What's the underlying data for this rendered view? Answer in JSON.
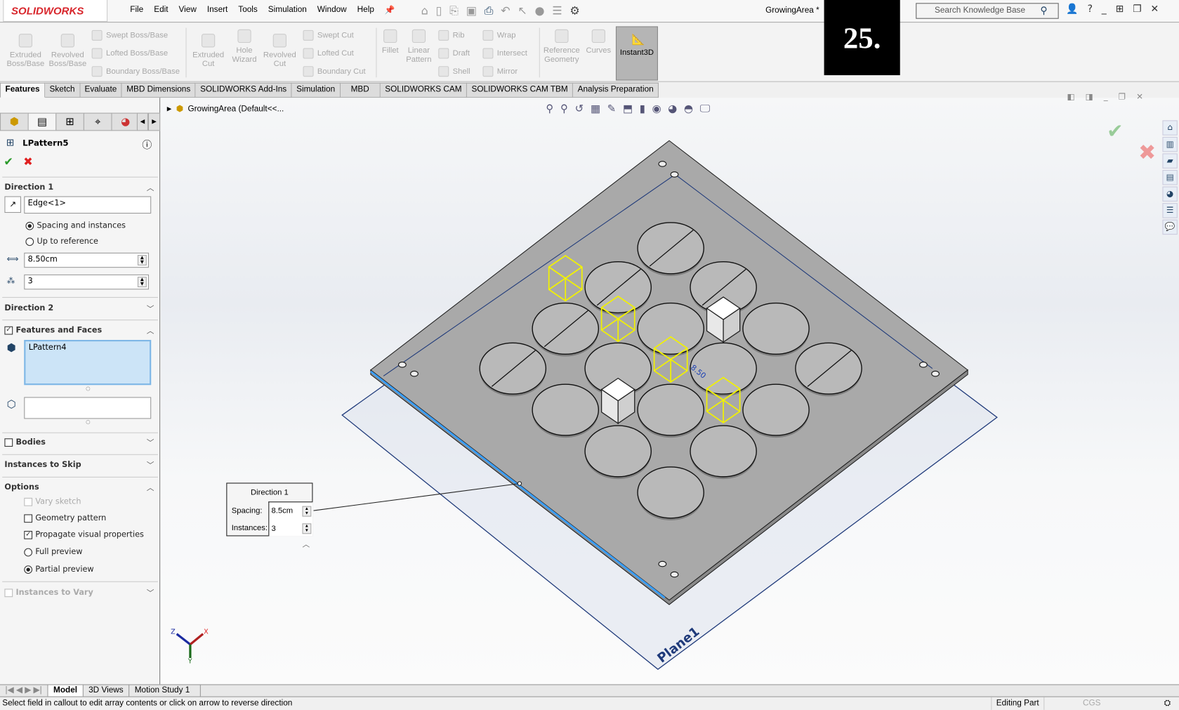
{
  "app": {
    "brand": "SOLIDWORKS",
    "document_title": "GrowingArea *",
    "step_badge": "25."
  },
  "menu": [
    "File",
    "Edit",
    "View",
    "Insert",
    "Tools",
    "Simulation",
    "Window",
    "Help"
  ],
  "search": {
    "placeholder": "Search Knowledge Base"
  },
  "ribbon": {
    "extruded_boss": "Extruded Boss/Base",
    "revolved_boss": "Revolved Boss/Base",
    "swept_boss": "Swept Boss/Base",
    "lofted_boss": "Lofted Boss/Base",
    "boundary_boss": "Boundary Boss/Base",
    "extruded_cut": "Extruded Cut",
    "hole_wizard": "Hole Wizard",
    "revolved_cut": "Revolved Cut",
    "swept_cut": "Swept Cut",
    "lofted_cut": "Lofted Cut",
    "boundary_cut": "Boundary Cut",
    "fillet": "Fillet",
    "linear_pattern": "Linear Pattern",
    "rib": "Rib",
    "draft": "Draft",
    "shell": "Shell",
    "wrap": "Wrap",
    "intersect": "Intersect",
    "mirror": "Mirror",
    "reference_geometry": "Reference Geometry",
    "curves": "Curves",
    "instant3d": "Instant3D"
  },
  "command_tabs": [
    "Features",
    "Sketch",
    "Evaluate",
    "MBD Dimensions",
    "SOLIDWORKS Add-Ins",
    "Simulation",
    "MBD",
    "SOLIDWORKS CAM",
    "SOLIDWORKS CAM TBM",
    "Analysis Preparation"
  ],
  "tree": {
    "root": "GrowingArea  (Default<<..."
  },
  "property_manager": {
    "title": "LPattern5",
    "direction1": {
      "label": "Direction 1",
      "edge": "Edge<1>",
      "opt_spacing": "Spacing and instances",
      "opt_upto": "Up to reference",
      "selected": "Spacing and instances",
      "spacing": "8.50cm",
      "instances": "3"
    },
    "direction2": {
      "label": "Direction 2"
    },
    "features": {
      "label": "Features and Faces",
      "checked": true,
      "item": "LPattern4"
    },
    "bodies": {
      "label": "Bodies",
      "checked": false
    },
    "skip": {
      "label": "Instances to Skip"
    },
    "options": {
      "label": "Options",
      "vary_sketch": "Vary sketch",
      "geometry_pattern": "Geometry pattern",
      "propagate": "Propagate visual properties",
      "full_preview": "Full preview",
      "partial_preview": "Partial preview",
      "preview_selected": "Partial preview"
    },
    "vary": {
      "label": "Instances to Vary"
    }
  },
  "callout": {
    "title": "Direction 1",
    "spacing_label": "Spacing:",
    "spacing": "8.5cm",
    "instances_label": "Instances:",
    "instances": "3"
  },
  "viewport": {
    "plane_label": "Plane1",
    "dim_label": "8.50",
    "triad": {
      "x": "X",
      "y": "Y",
      "z": "Z"
    }
  },
  "bottom_tabs": [
    "Model",
    "3D Views",
    "Motion Study 1"
  ],
  "status": {
    "message": "Select field in callout to edit array contents or click on arrow to reverse direction",
    "mode": "Editing Part",
    "units": "CGS"
  },
  "colors": {
    "brand": "#d8262c",
    "preview": "#f2f200",
    "selection": "#1a5fb4",
    "plane": "#1f3a7a"
  }
}
